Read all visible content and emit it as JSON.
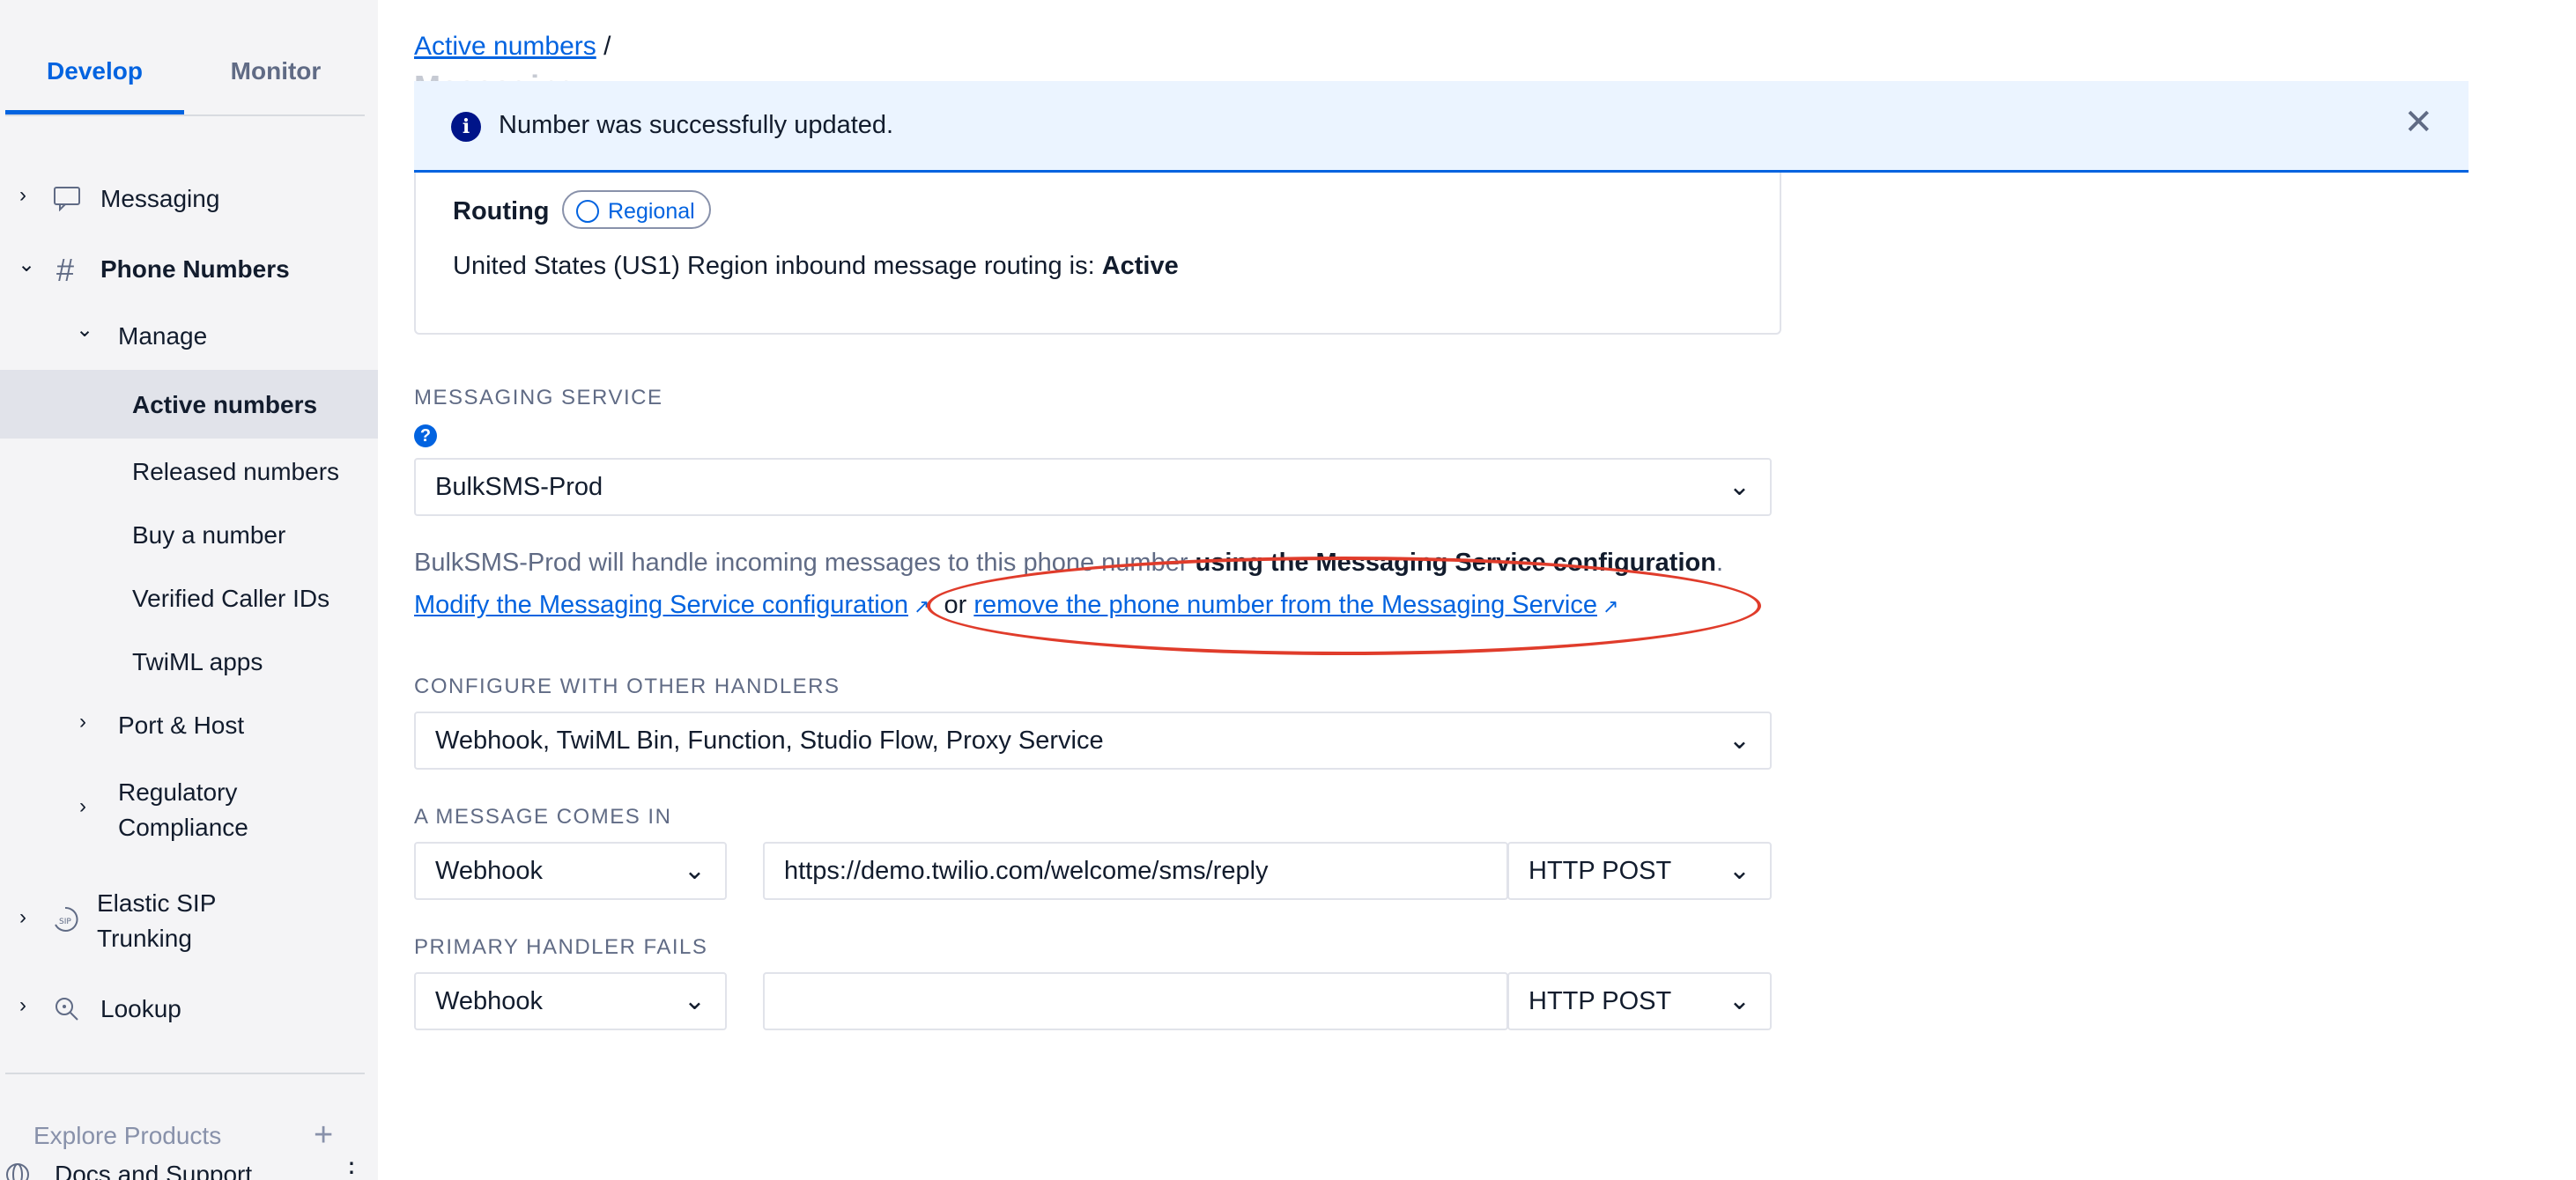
{
  "sidebar": {
    "tabs": {
      "develop": "Develop",
      "monitor": "Monitor"
    },
    "messaging": "Messaging",
    "phone_numbers": "Phone Numbers",
    "manage": "Manage",
    "active_numbers": "Active numbers",
    "released_numbers": "Released numbers",
    "buy_number": "Buy a number",
    "verified_caller_ids": "Verified Caller IDs",
    "twiml_apps": "TwiML apps",
    "port_host": "Port & Host",
    "regulatory_1": "Regulatory",
    "regulatory_2": "Compliance",
    "elastic_sip_1": "Elastic SIP",
    "elastic_sip_2": "Trunking",
    "lookup": "Lookup",
    "explore_products": "Explore Products",
    "docs_support": "Docs and Support"
  },
  "breadcrumb": {
    "link": "Active numbers",
    "sep": "/",
    "current": "Messaging"
  },
  "toast": {
    "message": "Number was successfully updated."
  },
  "routing": {
    "title": "Routing",
    "badge": "Regional",
    "text_prefix": "United States (US1) Region inbound message routing is: ",
    "status": "Active"
  },
  "messaging_service": {
    "label": "MESSAGING SERVICE",
    "selected": "BulkSMS-Prod",
    "helper_prefix": "BulkSMS-Prod will handle incoming messages to this phone number ",
    "helper_bold": "using the Messaging Service configuration",
    "helper_suffix": ".",
    "modify_link": "Modify the Messaging Service configuration",
    "or": "or",
    "remove_link": "remove the phone number from the Messaging Service"
  },
  "other_handlers": {
    "label": "CONFIGURE WITH OTHER HANDLERS",
    "selected": "Webhook, TwiML Bin, Function, Studio Flow, Proxy Service"
  },
  "message_comes_in": {
    "label": "A MESSAGE COMES IN",
    "type": "Webhook",
    "url": "https://demo.twilio.com/welcome/sms/reply",
    "method": "HTTP POST"
  },
  "primary_handler_fails": {
    "label": "PRIMARY HANDLER FAILS",
    "type": "Webhook",
    "url": "",
    "method": "HTTP POST"
  },
  "colors": {
    "accent": "#0263e0",
    "annotation": "#e03c2b",
    "toast_bg": "#ebf4ff"
  }
}
